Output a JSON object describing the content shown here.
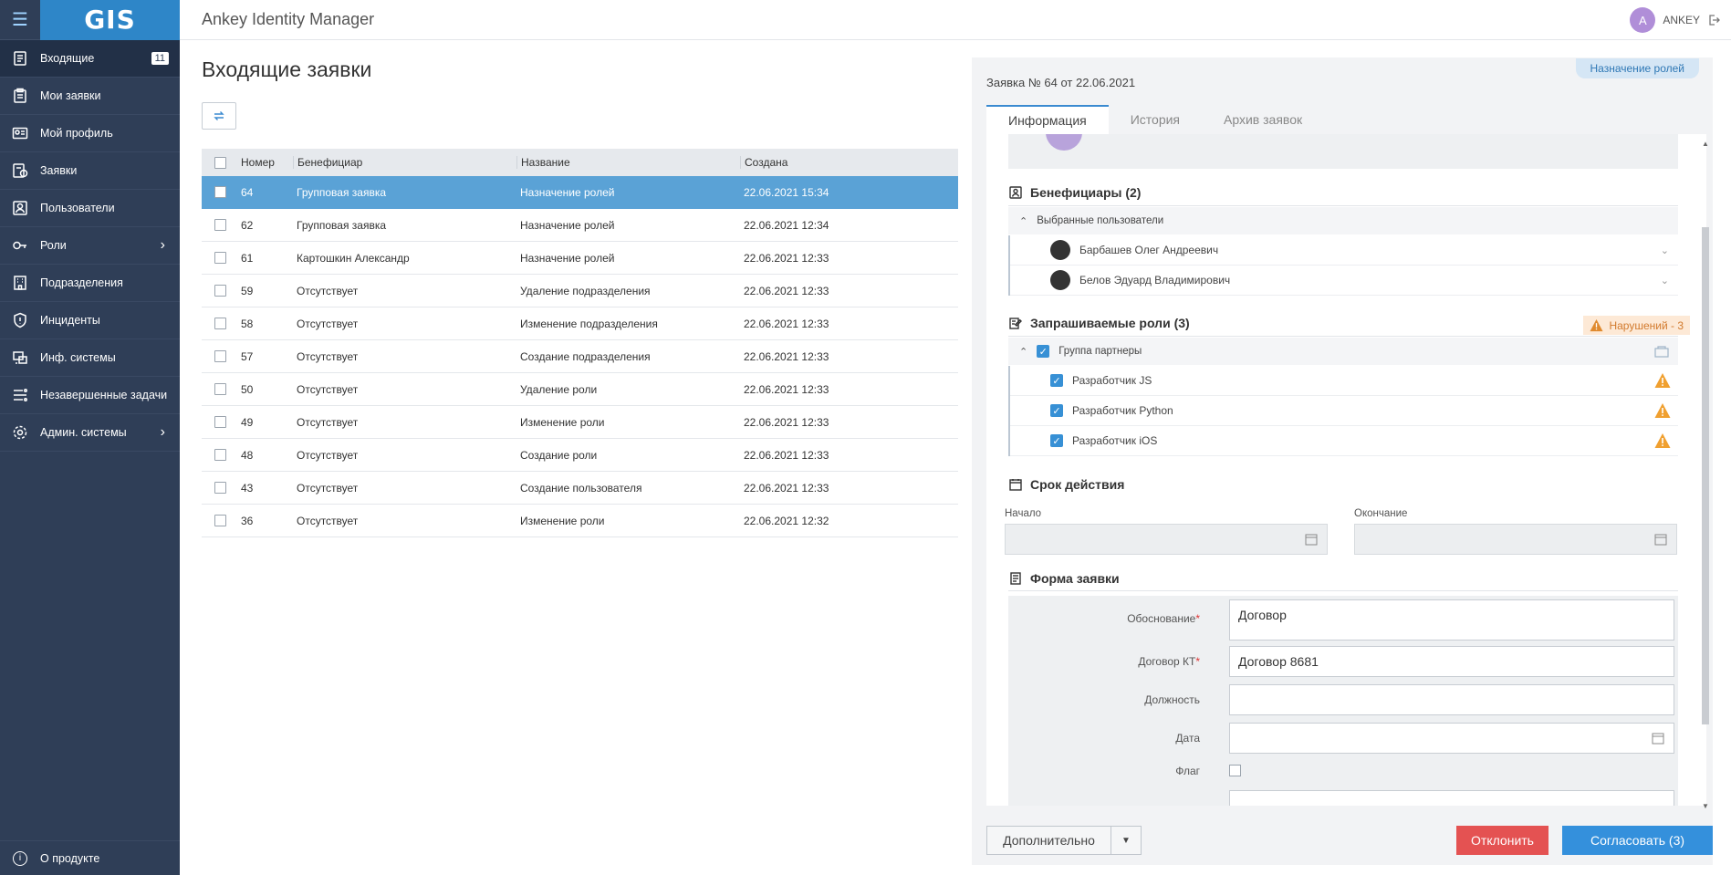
{
  "app": {
    "title": "Ankey Identity Manager",
    "logo": "GIS"
  },
  "user": {
    "initial": "A",
    "name": "ANKEY"
  },
  "sidebar": {
    "items": [
      {
        "label": "Входящие",
        "badge": "11",
        "icon": "inbox-icon"
      },
      {
        "label": "Мои заявки",
        "icon": "clipboard-icon"
      },
      {
        "label": "Мой профиль",
        "icon": "id-card-icon"
      },
      {
        "label": "Заявки",
        "icon": "requests-icon"
      },
      {
        "label": "Пользователи",
        "icon": "users-icon"
      },
      {
        "label": "Роли",
        "icon": "key-icon"
      },
      {
        "label": "Подразделения",
        "icon": "building-icon"
      },
      {
        "label": "Инциденты",
        "icon": "shield-icon"
      },
      {
        "label": "Инф. системы",
        "icon": "systems-icon"
      },
      {
        "label": "Незавершенные задачи",
        "icon": "tasks-icon"
      },
      {
        "label": "Админ. системы",
        "icon": "gear-icon"
      }
    ],
    "about": "О продукте"
  },
  "list": {
    "title": "Входящие заявки",
    "columns": {
      "number": "Номер",
      "beneficiary": "Бенефициар",
      "name": "Название",
      "created": "Создана"
    },
    "rows": [
      {
        "number": "64",
        "beneficiary": "Групповая заявка",
        "name": "Назначение ролей",
        "created": "22.06.2021 15:34"
      },
      {
        "number": "62",
        "beneficiary": "Групповая заявка",
        "name": "Назначение ролей",
        "created": "22.06.2021 12:34"
      },
      {
        "number": "61",
        "beneficiary": "Картошкин Александр",
        "name": "Назначение ролей",
        "created": "22.06.2021 12:33"
      },
      {
        "number": "59",
        "beneficiary": "Отсутствует",
        "name": "Удаление подразделения",
        "created": "22.06.2021 12:33"
      },
      {
        "number": "58",
        "beneficiary": "Отсутствует",
        "name": "Изменение подразделения",
        "created": "22.06.2021 12:33"
      },
      {
        "number": "57",
        "beneficiary": "Отсутствует",
        "name": "Создание подразделения",
        "created": "22.06.2021 12:33"
      },
      {
        "number": "50",
        "beneficiary": "Отсутствует",
        "name": "Удаление роли",
        "created": "22.06.2021 12:33"
      },
      {
        "number": "49",
        "beneficiary": "Отсутствует",
        "name": "Изменение роли",
        "created": "22.06.2021 12:33"
      },
      {
        "number": "48",
        "beneficiary": "Отсутствует",
        "name": "Создание роли",
        "created": "22.06.2021 12:33"
      },
      {
        "number": "43",
        "beneficiary": "Отсутствует",
        "name": "Создание пользователя",
        "created": "22.06.2021 12:33"
      },
      {
        "number": "36",
        "beneficiary": "Отсутствует",
        "name": "Изменение роли",
        "created": "22.06.2021 12:32"
      }
    ]
  },
  "detail": {
    "request_title": "Заявка № 64 от 22.06.2021",
    "type_tag": "Назначение ролей",
    "tabs": [
      "Информация",
      "История",
      "Архив заявок"
    ],
    "beneficiaries": {
      "title": "Бенефициары (2)",
      "group_label": "Выбранные пользователи",
      "users": [
        "Барбашев Олег Андреевич",
        "Белов Эдуард Владимирович"
      ]
    },
    "roles": {
      "title": "Запрашиваемые роли (3)",
      "violations": "Нарушений - 3",
      "group_label": "Группа партнеры",
      "items": [
        "Разработчик JS",
        "Разработчик Python",
        "Разработчик iOS"
      ]
    },
    "validity": {
      "title": "Срок действия",
      "start_label": "Начало",
      "end_label": "Окончание"
    },
    "form": {
      "title": "Форма заявки",
      "fields": {
        "reason": {
          "label": "Обоснование",
          "value": "Договор"
        },
        "contract": {
          "label": "Договор КТ",
          "value": "Договор 8681"
        },
        "position": {
          "label": "Должность",
          "value": ""
        },
        "date": {
          "label": "Дата",
          "value": ""
        },
        "flag": {
          "label": "Флаг"
        }
      },
      "required_mark": "*"
    },
    "buttons": {
      "more": "Дополнительно",
      "reject": "Отклонить",
      "approve": "Согласовать (3)"
    }
  },
  "colors": {
    "sidebar": "#2f3e57",
    "accent": "#3490dc",
    "selected_row": "#5aa2d6",
    "reject": "#e45252",
    "warning": "#f0a030"
  }
}
